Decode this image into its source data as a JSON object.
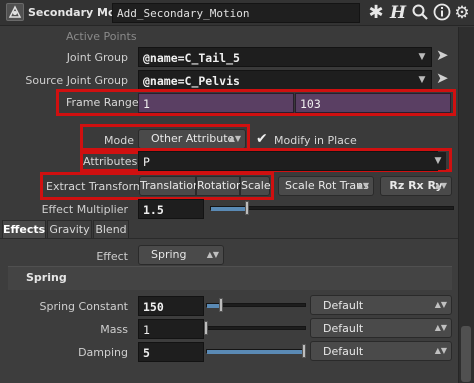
{
  "header": {
    "node_type": "Secondary Motion",
    "node_name": "Add_Secondary_Motion",
    "icons": [
      "node-icon",
      "gear-icon",
      "help-h-icon",
      "search-icon",
      "info-icon",
      "gear-icon"
    ]
  },
  "section_heading": "Active Points",
  "joint_group": {
    "label": "Joint Group",
    "value": "@name=C_Tail_5"
  },
  "source_joint_group": {
    "label": "Source Joint Group",
    "value": "@name=C_Pelvis"
  },
  "frame_range": {
    "label": "Frame Range",
    "start": "1",
    "end": "103"
  },
  "mode": {
    "label": "Mode",
    "value": "Other Attribute",
    "modify_in_place_label": "Modify in Place",
    "modify_in_place_checked": true
  },
  "attributes": {
    "label": "Attributes",
    "value": "P"
  },
  "extract_transform": {
    "label": "Extract Transform",
    "buttons": [
      "Translation",
      "Rotation",
      "Scale"
    ],
    "order_menu": "Scale Rot Trans",
    "rot_order_menu": "Rz Rx Ry"
  },
  "effect_multiplier": {
    "label": "Effect Multiplier",
    "value": "1.5",
    "fraction": 0.15
  },
  "tabs": [
    "Effects",
    "Gravity",
    "Blend"
  ],
  "active_tab": "Effects",
  "effect": {
    "label": "Effect",
    "value": "Spring"
  },
  "spring": {
    "title": "Spring",
    "spring_constant": {
      "label": "Spring Constant",
      "value": "150",
      "mode": "Default",
      "fraction": 0.15
    },
    "mass": {
      "label": "Mass",
      "value": "1",
      "mode": "Default",
      "fraction": 0.0
    },
    "damping": {
      "label": "Damping",
      "value": "5",
      "mode": "Default",
      "fraction": 1.0
    }
  },
  "colors": {
    "highlight": "#d01010",
    "purple_field": "#5a3f63",
    "slider_fill": "#5a8ab5"
  }
}
